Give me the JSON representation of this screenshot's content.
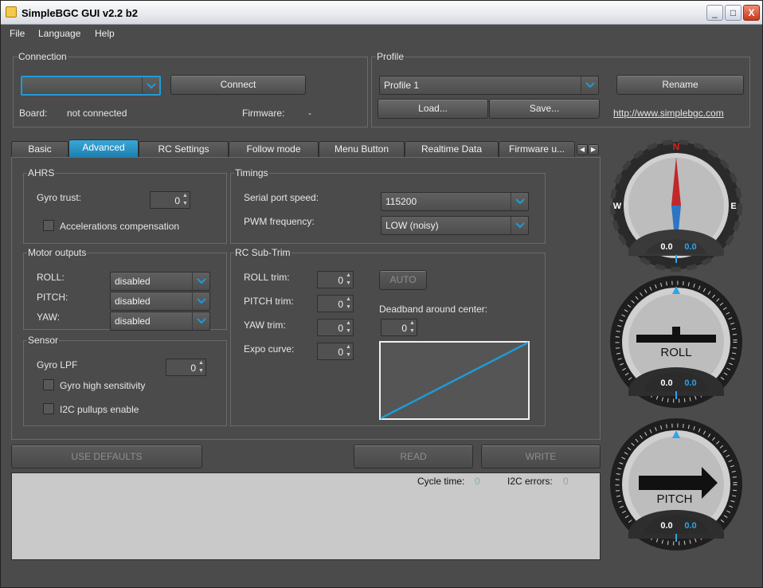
{
  "window": {
    "title": "SimpleBGC GUI v2.2 b2",
    "minimize": "_",
    "maximize": "□",
    "close": "X"
  },
  "menu": {
    "file": "File",
    "language": "Language",
    "help": "Help"
  },
  "connection": {
    "title": "Connection",
    "port_value": "",
    "connect_label": "Connect",
    "board_label": "Board:",
    "board_value": "not connected",
    "firmware_label": "Firmware:",
    "firmware_value": "-"
  },
  "profile": {
    "title": "Profile",
    "selected": "Profile 1",
    "rename_label": "Rename",
    "load_label": "Load...",
    "save_label": "Save...",
    "link": "http://www.simplebgc.com"
  },
  "tabs": [
    {
      "label": "Basic",
      "active": false
    },
    {
      "label": "Advanced",
      "active": true
    },
    {
      "label": "RC Settings",
      "active": false
    },
    {
      "label": "Follow mode",
      "active": false
    },
    {
      "label": "Menu Button",
      "active": false
    },
    {
      "label": "Realtime Data",
      "active": false
    },
    {
      "label": "Firmware u...",
      "active": false
    }
  ],
  "ahrs": {
    "title": "AHRS",
    "gyro_trust_label": "Gyro trust:",
    "gyro_trust_value": "0",
    "acc_comp_label": "Accelerations compensation",
    "acc_comp_checked": false
  },
  "timings": {
    "title": "Timings",
    "serial_label": "Serial port speed:",
    "serial_value": "115200",
    "pwm_label": "PWM frequency:",
    "pwm_value": "LOW (noisy)"
  },
  "motor_outputs": {
    "title": "Motor outputs",
    "roll_label": "ROLL:",
    "roll_value": "disabled",
    "pitch_label": "PITCH:",
    "pitch_value": "disabled",
    "yaw_label": "YAW:",
    "yaw_value": "disabled"
  },
  "sensor": {
    "title": "Sensor",
    "gyro_lpf_label": "Gyro LPF",
    "gyro_lpf_value": "0",
    "gyro_high_label": "Gyro high sensitivity",
    "gyro_high_checked": false,
    "i2c_label": "I2C pullups enable",
    "i2c_checked": false
  },
  "rc_subtrim": {
    "title": "RC Sub-Trim",
    "roll_trim_label": "ROLL trim:",
    "roll_trim_value": "0",
    "pitch_trim_label": "PITCH trim:",
    "pitch_trim_value": "0",
    "yaw_trim_label": "YAW trim:",
    "yaw_trim_value": "0",
    "expo_label": "Expo curve:",
    "expo_value": "0",
    "auto_label": "AUTO",
    "deadband_label": "Deadband around center:",
    "deadband_value": "0"
  },
  "actions": {
    "defaults": "USE DEFAULTS",
    "read": "READ",
    "write": "WRITE"
  },
  "status": {
    "cycle_label": "Cycle time:",
    "cycle_value": "0",
    "i2c_label": "I2C errors:",
    "i2c_value": "0"
  },
  "gauges": {
    "compass": {
      "north": "N",
      "west": "W",
      "east": "E",
      "value_left": "0.0",
      "value_right": "0.0"
    },
    "roll": {
      "label": "ROLL",
      "value_left": "0.0",
      "value_right": "0.0"
    },
    "pitch": {
      "label": "PITCH",
      "value_left": "0.0",
      "value_right": "0.0"
    }
  },
  "colors": {
    "accent": "#1e9bd7",
    "panel": "#4b4b4b",
    "status_bg": "#c9c9c9"
  }
}
